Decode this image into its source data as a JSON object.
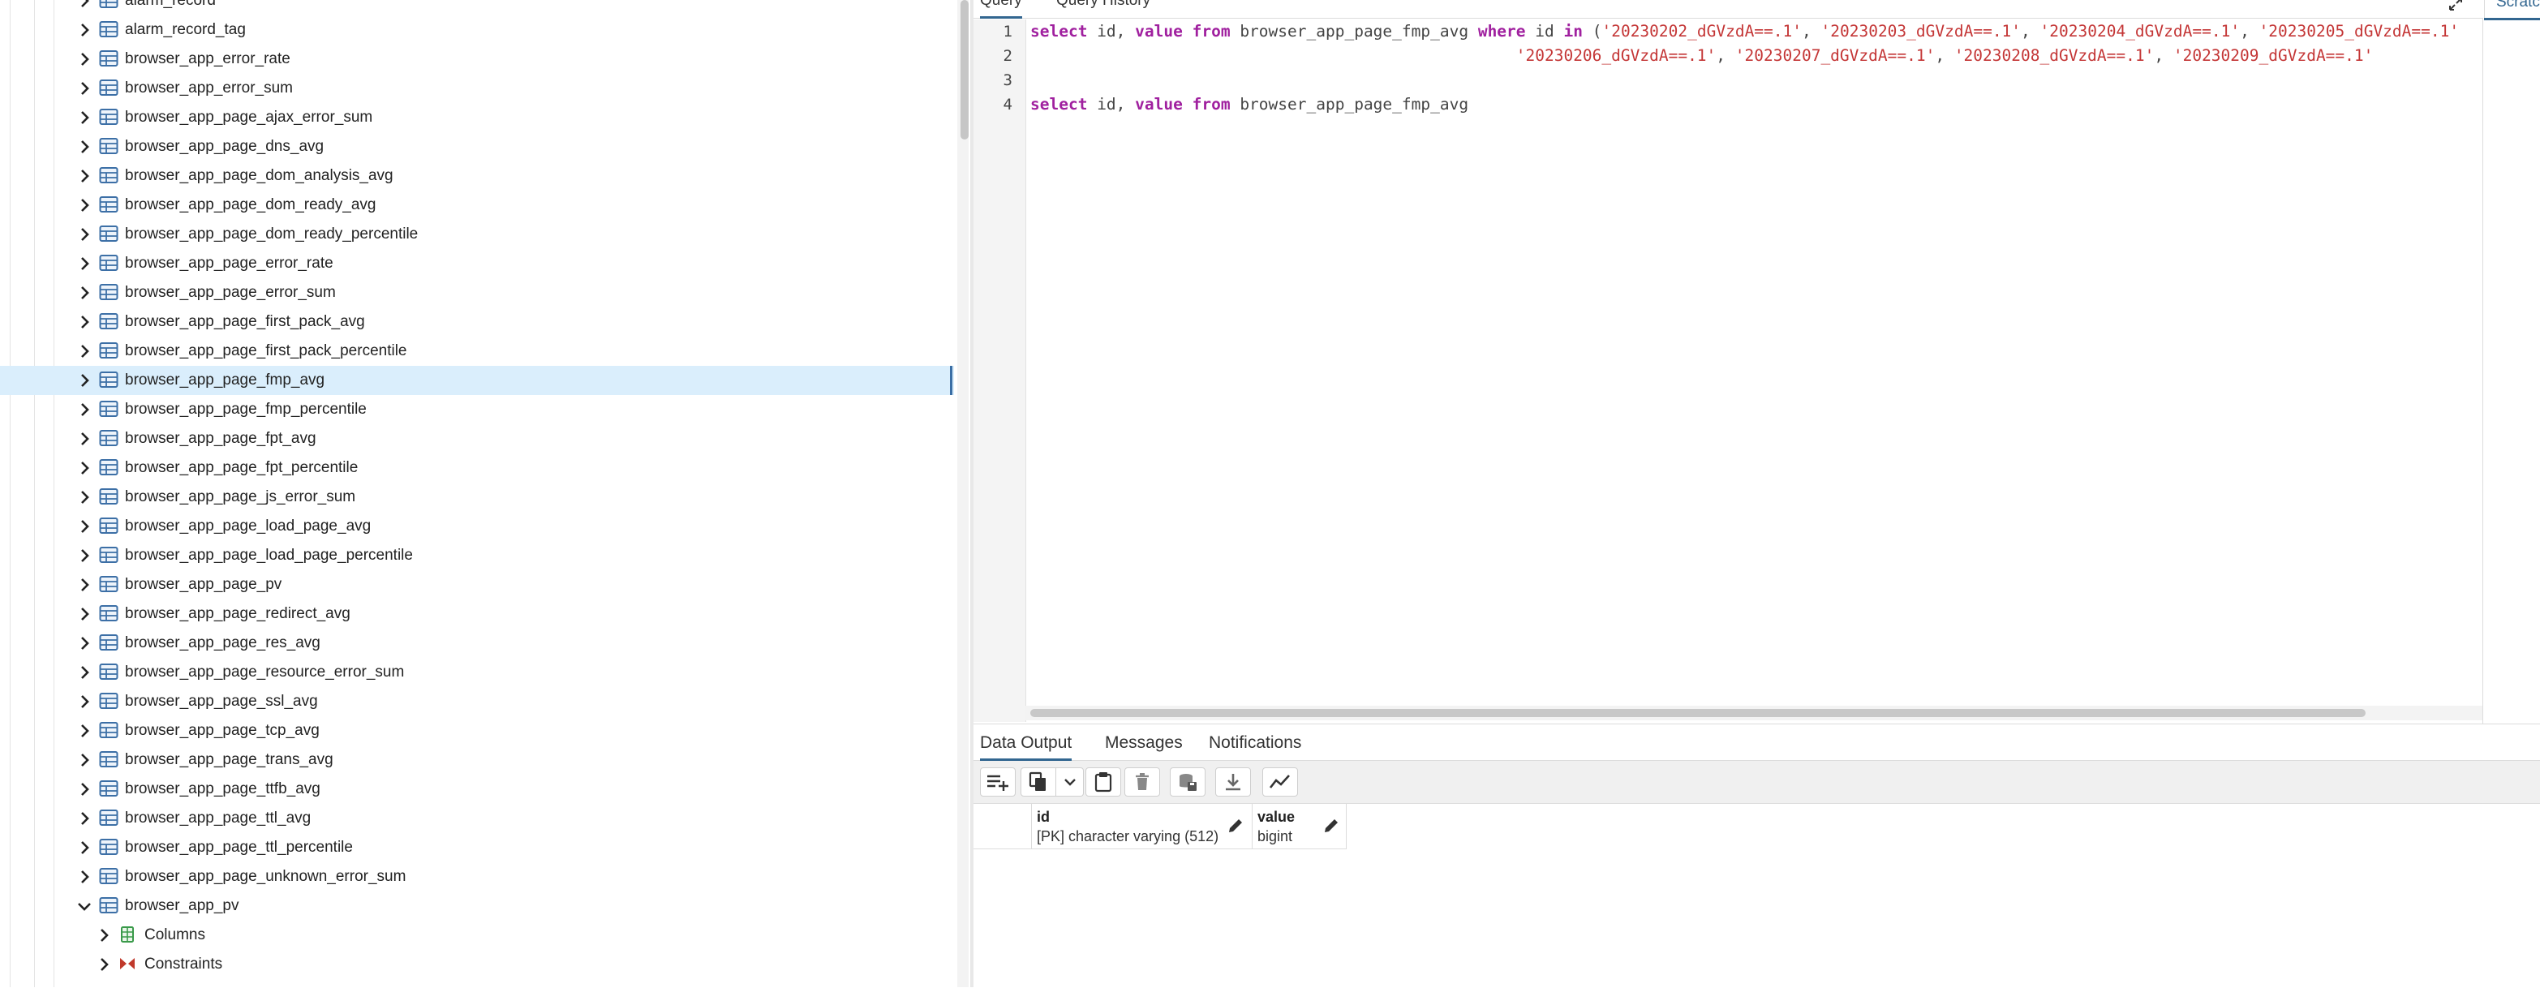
{
  "tree": {
    "items": [
      {
        "label": "alarm_record",
        "expanded": false,
        "kind": "table",
        "selected": false
      },
      {
        "label": "alarm_record_tag",
        "expanded": false,
        "kind": "table",
        "selected": false
      },
      {
        "label": "browser_app_error_rate",
        "expanded": false,
        "kind": "table",
        "selected": false
      },
      {
        "label": "browser_app_error_sum",
        "expanded": false,
        "kind": "table",
        "selected": false
      },
      {
        "label": "browser_app_page_ajax_error_sum",
        "expanded": false,
        "kind": "table",
        "selected": false
      },
      {
        "label": "browser_app_page_dns_avg",
        "expanded": false,
        "kind": "table",
        "selected": false
      },
      {
        "label": "browser_app_page_dom_analysis_avg",
        "expanded": false,
        "kind": "table",
        "selected": false
      },
      {
        "label": "browser_app_page_dom_ready_avg",
        "expanded": false,
        "kind": "table",
        "selected": false
      },
      {
        "label": "browser_app_page_dom_ready_percentile",
        "expanded": false,
        "kind": "table",
        "selected": false
      },
      {
        "label": "browser_app_page_error_rate",
        "expanded": false,
        "kind": "table",
        "selected": false
      },
      {
        "label": "browser_app_page_error_sum",
        "expanded": false,
        "kind": "table",
        "selected": false
      },
      {
        "label": "browser_app_page_first_pack_avg",
        "expanded": false,
        "kind": "table",
        "selected": false
      },
      {
        "label": "browser_app_page_first_pack_percentile",
        "expanded": false,
        "kind": "table",
        "selected": false
      },
      {
        "label": "browser_app_page_fmp_avg",
        "expanded": false,
        "kind": "table",
        "selected": true
      },
      {
        "label": "browser_app_page_fmp_percentile",
        "expanded": false,
        "kind": "table",
        "selected": false
      },
      {
        "label": "browser_app_page_fpt_avg",
        "expanded": false,
        "kind": "table",
        "selected": false
      },
      {
        "label": "browser_app_page_fpt_percentile",
        "expanded": false,
        "kind": "table",
        "selected": false
      },
      {
        "label": "browser_app_page_js_error_sum",
        "expanded": false,
        "kind": "table",
        "selected": false
      },
      {
        "label": "browser_app_page_load_page_avg",
        "expanded": false,
        "kind": "table",
        "selected": false
      },
      {
        "label": "browser_app_page_load_page_percentile",
        "expanded": false,
        "kind": "table",
        "selected": false
      },
      {
        "label": "browser_app_page_pv",
        "expanded": false,
        "kind": "table",
        "selected": false
      },
      {
        "label": "browser_app_page_redirect_avg",
        "expanded": false,
        "kind": "table",
        "selected": false
      },
      {
        "label": "browser_app_page_res_avg",
        "expanded": false,
        "kind": "table",
        "selected": false
      },
      {
        "label": "browser_app_page_resource_error_sum",
        "expanded": false,
        "kind": "table",
        "selected": false
      },
      {
        "label": "browser_app_page_ssl_avg",
        "expanded": false,
        "kind": "table",
        "selected": false
      },
      {
        "label": "browser_app_page_tcp_avg",
        "expanded": false,
        "kind": "table",
        "selected": false
      },
      {
        "label": "browser_app_page_trans_avg",
        "expanded": false,
        "kind": "table",
        "selected": false
      },
      {
        "label": "browser_app_page_ttfb_avg",
        "expanded": false,
        "kind": "table",
        "selected": false
      },
      {
        "label": "browser_app_page_ttl_avg",
        "expanded": false,
        "kind": "table",
        "selected": false
      },
      {
        "label": "browser_app_page_ttl_percentile",
        "expanded": false,
        "kind": "table",
        "selected": false
      },
      {
        "label": "browser_app_page_unknown_error_sum",
        "expanded": false,
        "kind": "table",
        "selected": false
      },
      {
        "label": "browser_app_pv",
        "expanded": true,
        "kind": "table",
        "selected": false
      },
      {
        "label": "Columns",
        "expanded": false,
        "kind": "columns",
        "selected": false
      },
      {
        "label": "Constraints",
        "expanded": false,
        "kind": "constraints",
        "selected": false
      }
    ]
  },
  "editor": {
    "tabs": [
      {
        "label": "Query",
        "active": true
      },
      {
        "label": "Query History",
        "active": false
      }
    ],
    "scratch_label": "Scratch Pad",
    "line_numbers": [
      "1",
      "2",
      "3",
      "4"
    ],
    "lines": [
      [
        {
          "t": "kw",
          "v": "select"
        },
        {
          "t": "plain",
          "v": " id, "
        },
        {
          "t": "kw",
          "v": "value"
        },
        {
          "t": "plain",
          "v": " "
        },
        {
          "t": "kw",
          "v": "from"
        },
        {
          "t": "plain",
          "v": " browser_app_page_fmp_avg "
        },
        {
          "t": "kw",
          "v": "where"
        },
        {
          "t": "plain",
          "v": " id "
        },
        {
          "t": "kw",
          "v": "in"
        },
        {
          "t": "plain",
          "v": " ("
        },
        {
          "t": "str",
          "v": "'20230202_dGVzdA==.1'"
        },
        {
          "t": "plain",
          "v": ", "
        },
        {
          "t": "str",
          "v": "'20230203_dGVzdA==.1'"
        },
        {
          "t": "plain",
          "v": ", "
        },
        {
          "t": "str",
          "v": "'20230204_dGVzdA==.1'"
        },
        {
          "t": "plain",
          "v": ", "
        },
        {
          "t": "str",
          "v": "'20230205_dGVzdA==.1'"
        }
      ],
      [
        {
          "t": "plain",
          "v": "                                                   "
        },
        {
          "t": "str",
          "v": "'20230206_dGVzdA==.1'"
        },
        {
          "t": "plain",
          "v": ", "
        },
        {
          "t": "str",
          "v": "'20230207_dGVzdA==.1'"
        },
        {
          "t": "plain",
          "v": ", "
        },
        {
          "t": "str",
          "v": "'20230208_dGVzdA==.1'"
        },
        {
          "t": "plain",
          "v": ", "
        },
        {
          "t": "str",
          "v": "'20230209_dGVzdA==.1'"
        }
      ],
      [],
      [
        {
          "t": "kw",
          "v": "select"
        },
        {
          "t": "plain",
          "v": " id, "
        },
        {
          "t": "kw",
          "v": "value"
        },
        {
          "t": "plain",
          "v": " "
        },
        {
          "t": "kw",
          "v": "from"
        },
        {
          "t": "plain",
          "v": " browser_app_page_fmp_avg"
        }
      ]
    ]
  },
  "results": {
    "tabs": [
      {
        "label": "Data Output",
        "active": true
      },
      {
        "label": "Messages",
        "active": false
      },
      {
        "label": "Notifications",
        "active": false
      }
    ],
    "toolbar": [
      {
        "name": "add-row-button",
        "icon": "add-row-icon"
      },
      {
        "name": "copy-button",
        "icon": "copy-icon"
      },
      {
        "name": "copy-options-dropdown",
        "icon": "chevron-down-icon"
      },
      {
        "name": "paste-button",
        "icon": "paste-icon"
      },
      {
        "name": "delete-button",
        "icon": "trash-icon"
      },
      {
        "name": "save-data-button",
        "icon": "save-data-icon"
      },
      {
        "name": "download-button",
        "icon": "download-icon"
      },
      {
        "name": "graph-button",
        "icon": "graph-icon"
      }
    ],
    "columns": [
      {
        "name": "id",
        "type": "[PK] character varying (512)"
      },
      {
        "name": "value",
        "type": "bigint"
      }
    ]
  },
  "colors": {
    "keyword": "#a0209f",
    "string": "#c43636",
    "accent": "#326690",
    "selected_row": "#daeefc",
    "table_icon": "#3c6fa6"
  }
}
